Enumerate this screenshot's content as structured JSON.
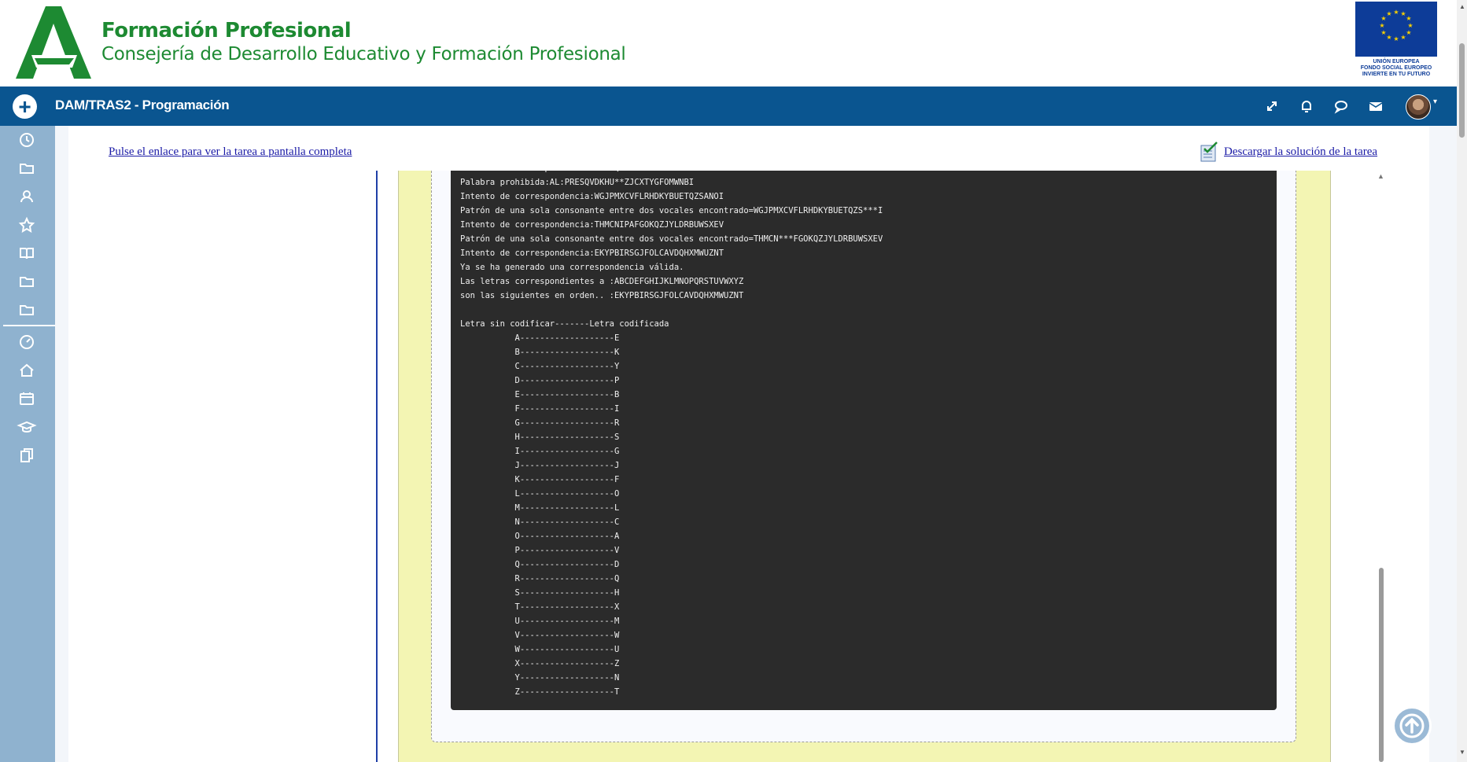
{
  "header": {
    "title": "Formación Profesional",
    "subtitle": "Consejería de Desarrollo Educativo y Formación Profesional",
    "eu_lines": [
      "UNIÓN EUROPEA",
      "FONDO SOCIAL EUROPEO",
      "INVIERTE EN TU FUTURO"
    ],
    "brand_color": "#1d8a32"
  },
  "navbar": {
    "add_label": "+",
    "course_title": "DAM/TRAS2 - Programación",
    "icons": [
      "expand-icon",
      "bell-icon",
      "chat-icon",
      "mail-icon"
    ],
    "avatar_caret": "▾",
    "color": "#0a5590"
  },
  "sidebar": {
    "icons": [
      "clock-icon",
      "folder-icon",
      "users-icon",
      "star-icon",
      "book-icon",
      "folder-icon",
      "folder-icon",
      "dashboard-icon",
      "home-icon",
      "calendar-icon",
      "graduation-cap-icon",
      "copy-icon"
    ]
  },
  "content": {
    "full_screen_link": "Pulse el enlace para ver la tarea a pantalla completa",
    "download_link": "Descargar la solución de la tarea"
  },
  "terminal": {
    "lines": [
      "Intento de correspondencia:PRESQVDKHUAZJCXTYGFOMWNBI",
      "Palabra prohibida:AL:PRESQVDKHU**ZJCXTYGFOMWNBI",
      "Intento de correspondencia:WGJPMXCVFLRHDKYBUETQZSANOI",
      "Patrón de una sola consonante entre dos vocales encontrado=WGJPMXCVFLRHDKYBUETQZS***I",
      "Intento de correspondencia:THMCNIPAFGOKQZJYLDRBUWSXEV",
      "Patrón de una sola consonante entre dos vocales encontrado=THMCN***FGOKQZJYLDRBUWSXEV",
      "Intento de correspondencia:EKYPBIRSGJFOLCAVDQHXMWUZNT",
      "Ya se ha generado una correspondencia válida.",
      "Las letras correspondientes a :ABCDEFGHIJKLMNOPQRSTUVWXYZ",
      "son las siguientes en orden.. :EKYPBIRSGJFOLCAVDQHXMWUZNT",
      "",
      "Letra sin codificar-------Letra codificada",
      "           A-------------------E",
      "           B-------------------K",
      "           C-------------------Y",
      "           D-------------------P",
      "           E-------------------B",
      "           F-------------------I",
      "           G-------------------R",
      "           H-------------------S",
      "           I-------------------G",
      "           J-------------------J",
      "           K-------------------F",
      "           L-------------------O",
      "           M-------------------L",
      "           N-------------------C",
      "           O-------------------A",
      "           P-------------------V",
      "           Q-------------------D",
      "           R-------------------Q",
      "           S-------------------H",
      "           T-------------------X",
      "           U-------------------M",
      "           V-------------------W",
      "           W-------------------U",
      "           X-------------------Z",
      "           Y-------------------N",
      "           Z-------------------T"
    ]
  }
}
